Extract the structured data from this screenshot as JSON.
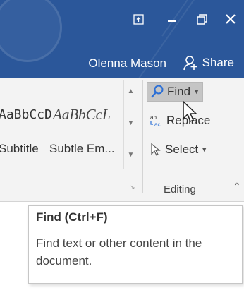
{
  "titlebar": {
    "user_name": "Olenna Mason",
    "share_label": "Share",
    "bg_color": "#2b579a",
    "icons": [
      "ribbon-display-options-icon",
      "minimize-icon",
      "restore-icon",
      "close-icon",
      "person-add-icon"
    ]
  },
  "styles_gallery": {
    "items": [
      "AaBbCcD",
      "AaBbCcL",
      "Subtitle",
      "Subtle Em..."
    ]
  },
  "editing": {
    "find_label": "Find",
    "replace_label": "Replace",
    "select_label": "Select",
    "group_label": "Editing"
  },
  "tooltip": {
    "title": "Find (Ctrl+F)",
    "description": "Find text or other content in the document."
  }
}
